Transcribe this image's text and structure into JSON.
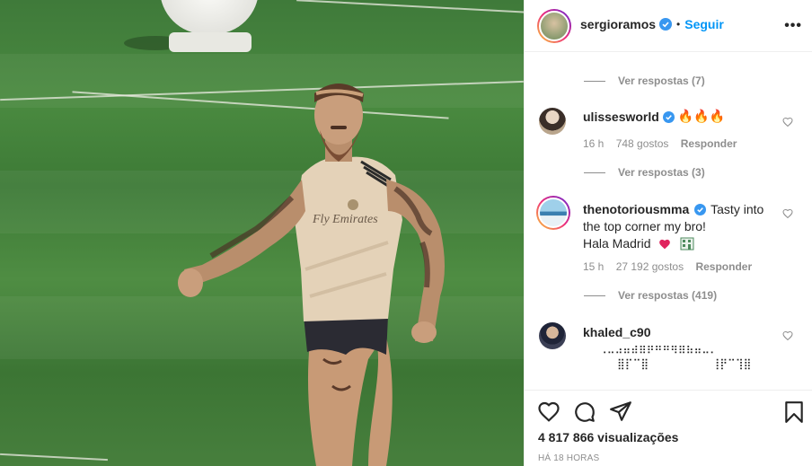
{
  "post": {
    "username": "sergioramos",
    "separator": "•",
    "follow_label": "Seguir",
    "more_label": "•••"
  },
  "media": {
    "jersey_text": "Fly Emirates"
  },
  "comments": {
    "top_partial": {
      "view_replies": "Ver respostas (7)"
    },
    "items": [
      {
        "username": "ulissesworld",
        "verified": true,
        "text": "🔥🔥🔥",
        "time": "16 h",
        "likes": "748 gostos",
        "reply": "Responder",
        "view_replies": "Ver respostas (3)"
      },
      {
        "username": "thenotoriousmma",
        "verified": true,
        "text_line1": "Tasty into",
        "text_line2": "the top corner my bro!",
        "text_line3": "Hala Madrid",
        "time": "15 h",
        "likes": "27 192 gostos",
        "reply": "Responder",
        "view_replies": "Ver respostas (419)"
      },
      {
        "username": "khaled_c90",
        "verified": false,
        "braille_line1": "⢀⣀⣠⣤⣴⣶⡶⠶⠶⢶⣶⣦⣤⣀⡀",
        "braille_line2": "⣿⡏⠉⣿⠀⠀⠀⠀⠀⠀⠀⠀⢸⡟⠉⢹⣿"
      }
    ]
  },
  "footer": {
    "views": "4 817 866 visualizações",
    "timestamp": "HÁ 18 HORAS"
  },
  "colors": {
    "accent": "#0095f6",
    "verified": "#3897f0",
    "muted": "#8e8e8e",
    "text": "#262626"
  }
}
